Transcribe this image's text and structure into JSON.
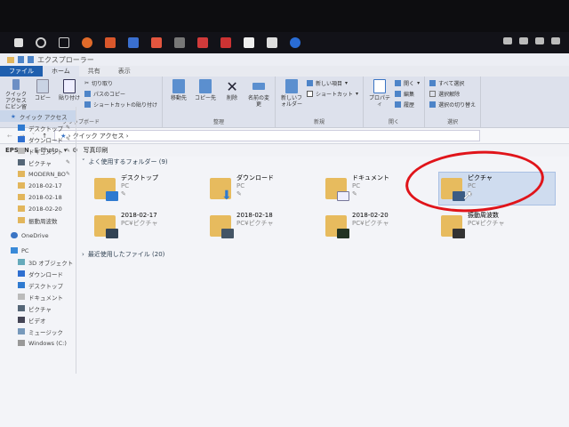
{
  "taskbar": {
    "icons": [
      "start",
      "search",
      "task-view",
      "firefox",
      "app",
      "app2",
      "app3",
      "app4",
      "app5",
      "app6",
      "app7",
      "store",
      "edge"
    ]
  },
  "window": {
    "title": "エクスプローラー"
  },
  "tabs": [
    "ファイル",
    "ホーム",
    "共有",
    "表示"
  ],
  "ribbon": {
    "clipboard": {
      "label": "クリップボード",
      "pin": "クイック アクセスにピン留め",
      "copy": "コピー",
      "paste": "貼り付け",
      "cut": "切り取り",
      "copy_path": "パスのコピー",
      "paste_shortcut": "ショートカットの貼り付け"
    },
    "organize": {
      "label": "整理",
      "move_to": "移動先",
      "copy_to": "コピー先",
      "delete": "削除",
      "rename": "名前の変更"
    },
    "new": {
      "label": "新規",
      "new_folder": "新しいフォルダー",
      "new_item": "新しい項目",
      "shortcut": "ショートカット"
    },
    "open": {
      "label": "開く",
      "properties": "プロパティ",
      "open": "開く",
      "edit": "編集",
      "history": "履歴"
    },
    "select": {
      "label": "選択",
      "select_all": "すべて選択",
      "select_none": "選択解除",
      "invert": "選択の切り替え"
    }
  },
  "address": {
    "path": "クイック アクセス"
  },
  "epson": {
    "brand": "EPSON",
    "app": "E-Photo",
    "print": "写真印刷"
  },
  "sidebar": {
    "quick_access": "クイック アクセス",
    "quick_items": [
      "デスクトップ",
      "ダウンロード",
      "ドキュメント",
      "ピクチャ",
      "MODERN_BO",
      "2018-02-17",
      "2018-02-18",
      "2018-02-20",
      "振動周波数"
    ],
    "onedrive": "OneDrive",
    "pc": "PC",
    "pc_items": [
      "3D オブジェクト",
      "ダウンロード",
      "デスクトップ",
      "ドキュメント",
      "ピクチャ",
      "ビデオ",
      "ミュージック",
      "Windows (C:)"
    ]
  },
  "content": {
    "frequent_header": "よく使用するフォルダー (9)",
    "folders": [
      {
        "name": "デスクトップ",
        "loc": "PC",
        "pinned": true
      },
      {
        "name": "ダウンロード",
        "loc": "PC",
        "pinned": true
      },
      {
        "name": "ドキュメント",
        "loc": "PC",
        "pinned": true
      },
      {
        "name": "ピクチャ",
        "loc": "PC",
        "pinned": true
      },
      {
        "name": "2018-02-17",
        "loc": "PC¥ピクチャ"
      },
      {
        "name": "2018-02-18",
        "loc": "PC¥ピクチャ"
      },
      {
        "name": "2018-02-20",
        "loc": "PC¥ピクチャ"
      },
      {
        "name": "振動周波数",
        "loc": "PC¥ピクチャ"
      }
    ],
    "recent_header": "最近使用したファイル (20)"
  },
  "colors": {
    "accent": "#1f5fae",
    "highlight": "#e0141a"
  }
}
